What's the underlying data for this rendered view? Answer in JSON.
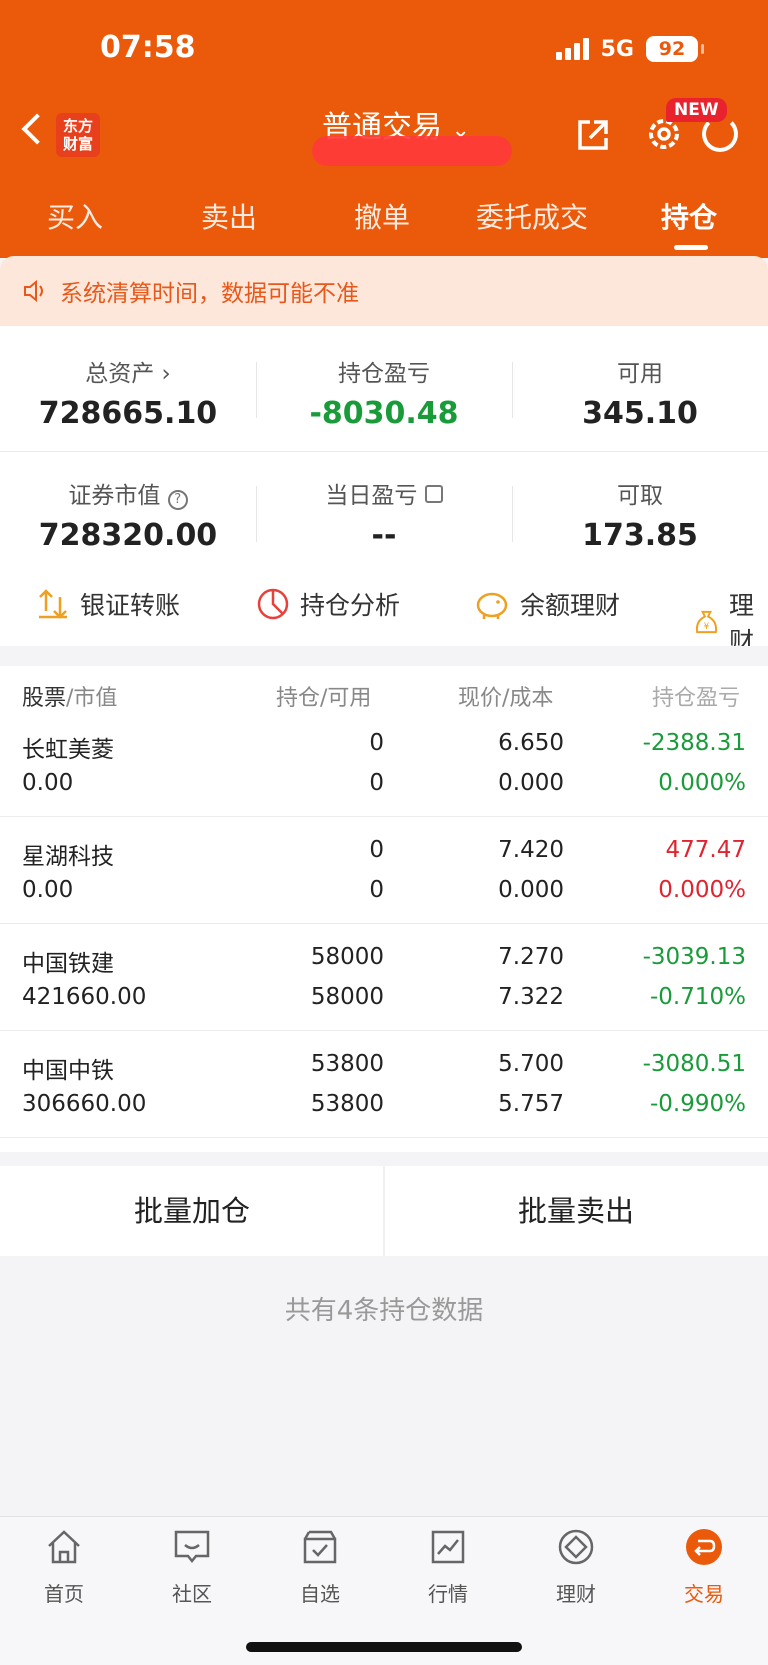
{
  "status_bar": {
    "time": "07:58",
    "network": "5G",
    "battery": "92"
  },
  "header": {
    "logo_text": "东方\n财富",
    "title": "普通交易",
    "new_badge": "NEW",
    "accent_color": "#ea5a0a"
  },
  "tabs": [
    {
      "label": "买入"
    },
    {
      "label": "卖出"
    },
    {
      "label": "撤单"
    },
    {
      "label": "委托成交"
    },
    {
      "label": "持仓",
      "active": true
    }
  ],
  "notice": {
    "text": "系统清算时间，数据可能不准"
  },
  "summary": {
    "total_assets_label": "总资产",
    "total_assets": "728665.10",
    "position_pnl_label": "持仓盈亏",
    "position_pnl": "-8030.48",
    "available_label": "可用",
    "available": "345.10",
    "market_value_label": "证券市值",
    "market_value": "728320.00",
    "daily_pnl_label": "当日盈亏",
    "daily_pnl": "--",
    "withdrawable_label": "可取",
    "withdrawable": "173.85"
  },
  "quick_actions": [
    {
      "label": "银证转账",
      "icon": "transfer-icon"
    },
    {
      "label": "持仓分析",
      "icon": "pie-chart-icon"
    },
    {
      "label": "余额理财",
      "icon": "piggy-bank-icon"
    },
    {
      "label": "理财",
      "icon": "money-bag-icon"
    }
  ],
  "table_headers": {
    "stock": "股票",
    "market_value": "/市值",
    "position": "持仓/可用",
    "price": "现价/成本",
    "pnl": "持仓盈亏"
  },
  "holdings": [
    {
      "name": "长虹美菱",
      "market_value": "0.00",
      "position": "0",
      "available": "0",
      "price": "6.650",
      "cost": "0.000",
      "pnl": "-2388.31",
      "pnl_pct": "0.000%",
      "trend": "down"
    },
    {
      "name": "星湖科技",
      "market_value": "0.00",
      "position": "0",
      "available": "0",
      "price": "7.420",
      "cost": "0.000",
      "pnl": "477.47",
      "pnl_pct": "0.000%",
      "trend": "up"
    },
    {
      "name": "中国铁建",
      "market_value": "421660.00",
      "position": "58000",
      "available": "58000",
      "price": "7.270",
      "cost": "7.322",
      "pnl": "-3039.13",
      "pnl_pct": "-0.710%",
      "trend": "down"
    },
    {
      "name": "中国中铁",
      "market_value": "306660.00",
      "position": "53800",
      "available": "53800",
      "price": "5.700",
      "cost": "5.757",
      "pnl": "-3080.51",
      "pnl_pct": "-0.990%",
      "trend": "down"
    }
  ],
  "batch": {
    "add_label": "批量加仓",
    "sell_label": "批量卖出"
  },
  "footer_text": "共有4条持仓数据",
  "bottom_nav": [
    {
      "label": "首页",
      "icon": "home-icon"
    },
    {
      "label": "社区",
      "icon": "community-icon"
    },
    {
      "label": "自选",
      "icon": "watchlist-icon"
    },
    {
      "label": "行情",
      "icon": "market-icon"
    },
    {
      "label": "理财",
      "icon": "finance-icon"
    },
    {
      "label": "交易",
      "icon": "trade-icon",
      "active": true
    }
  ]
}
